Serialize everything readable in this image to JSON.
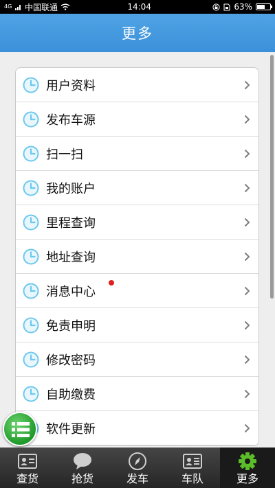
{
  "status_bar": {
    "signal_badge": "4G",
    "carrier": "中国联通",
    "time": "14:04",
    "battery": "63%",
    "battery_level": 0.63
  },
  "header": {
    "title": "更多"
  },
  "menu": {
    "items": [
      {
        "label": "用户资料",
        "badge": false
      },
      {
        "label": "发布车源",
        "badge": false
      },
      {
        "label": "扫一扫",
        "badge": false
      },
      {
        "label": "我的账户",
        "badge": false
      },
      {
        "label": "里程查询",
        "badge": false
      },
      {
        "label": "地址查询",
        "badge": false
      },
      {
        "label": "消息中心",
        "badge": true
      },
      {
        "label": "免责申明",
        "badge": false
      },
      {
        "label": "修改密码",
        "badge": false
      },
      {
        "label": "自助缴费",
        "badge": false
      },
      {
        "label": "软件更新",
        "badge": false
      }
    ]
  },
  "bottom_nav": {
    "items": [
      {
        "label": "查货",
        "icon": "id-card-icon"
      },
      {
        "label": "抢货",
        "icon": "chat-bubble-icon"
      },
      {
        "label": "发车",
        "icon": "compass-icon"
      },
      {
        "label": "车队",
        "icon": "contact-card-icon"
      },
      {
        "label": "更多",
        "icon": "gear-icon",
        "active": true
      }
    ]
  },
  "colors": {
    "header": "#3b90d9",
    "icon_accent": "#6cc8ef",
    "active_tab": "#5bbd2a",
    "badge": "#e02020"
  }
}
